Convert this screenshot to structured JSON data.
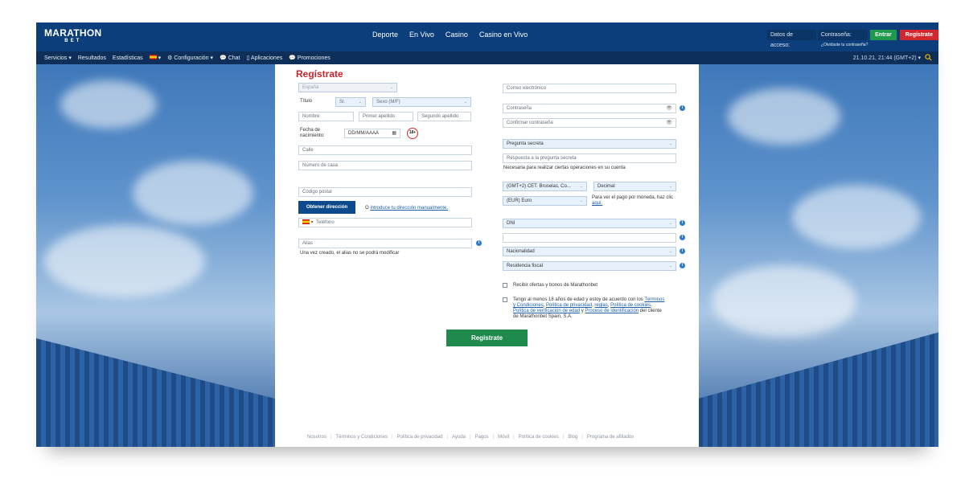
{
  "brand": {
    "name": "MARATHON",
    "sub": "BET"
  },
  "main_nav": [
    "Deporte",
    "En Vivo",
    "Casino",
    "Casino en Vivo"
  ],
  "login": {
    "label": "Datos de acceso:",
    "password_placeholder": "Contraseña:",
    "enter": "Entrar",
    "register": "Regístrate",
    "forgot": "¿Olvidaste tu contraseña?"
  },
  "sub_nav": {
    "services": "Servicios",
    "results": "Resultados",
    "stats": "Estadísticas",
    "config": "Configuración",
    "chat": "Chat",
    "apps": "Aplicaciones",
    "promos": "Promociones"
  },
  "clock": "21.10.21, 21:44 (GMT+2)",
  "colors": {
    "header": "#0b3e7a",
    "subbar": "#0e2f5a",
    "accent_red": "#c8242b",
    "green": "#1f8a4c",
    "link": "#1d5ea8"
  },
  "form": {
    "title": "Regístrate",
    "country": "España",
    "title_label": "Título",
    "title_value": "Sr.",
    "sex": "Sexo (M/F)",
    "first_name": "Nombre",
    "last_name_1": "Primer apellido",
    "last_name_2": "Segundo apellido",
    "dob_label": "Fecha de nacimiento:",
    "dob_placeholder": "DD/MM/AAAA",
    "age_badge": "18+",
    "street": "Calle",
    "house_number": "Número de casa",
    "postal_code": "Código postal",
    "get_address": "Obtener dirección",
    "or": "O",
    "manual_address": "introduce tu dirección manualmente.",
    "phone": "Teléfono",
    "alias": "Alias",
    "alias_note": "Una vez creado, el alias no se podrá modificar",
    "email": "Correo electrónico",
    "password": "Contraseña",
    "confirm_password": "Confirmar contraseña",
    "secret_question": "Pregunta secreta",
    "secret_answer": "Respuesta a la pregunta secreta",
    "secret_note": "Necesaria para realizar ciertas operaciones en su cuenta",
    "timezone": "(GMT+2) CET. Bruselas, Co...",
    "odds_format": "Decimal",
    "currency": "(EUR) Euro",
    "currency_note": "Para ver el pago por moneda, haz clic",
    "currency_link": "aquí.",
    "id_type": "DNI",
    "nationality": "Nacionalidad",
    "tax_residence": "Residencia fiscal",
    "offers": "Recibir ofertas y bonos de Marathonbet",
    "terms_intro": "Tengo al menos 18 años de edad y estoy de acuerdo con los",
    "terms_link_1": "Términos y Condiciones",
    "privacy_link": "Política de privacidad",
    "rules_link": "reglas",
    "cookies_link": "Política de cookies",
    "age_verification_link": "Política de verificación de edad",
    "and": "y",
    "id_process_link": "Proceso de identificación",
    "terms_outro": "del cliente de Marathonbet Spain, S.A.",
    "submit": "Regístrate"
  },
  "footer": [
    "Nosotros",
    "Términos y Condiciones",
    "Política de privacidad",
    "Ayuda",
    "Pagos",
    "Móvil",
    "Política de cookies",
    "Blog",
    "Programa de afiliados"
  ]
}
